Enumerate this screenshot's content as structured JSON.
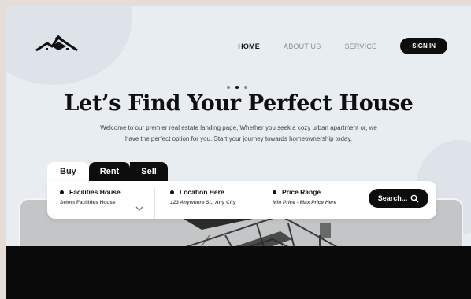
{
  "nav": {
    "home": "HOME",
    "about": "ABOUT US",
    "service": "SERVICE",
    "signin": "SIGN IN"
  },
  "hero": {
    "title": "Let’s Find Your Perfect House",
    "subtitle_line1": "Welcome to our premier real estate landing page, Whether you seek a cozy urban apartment or, we",
    "subtitle_line2": "have the perfect option for you. Start your journey towards homeownership today."
  },
  "tabs": [
    "Buy",
    "Rent",
    "Sell"
  ],
  "search": {
    "facilities": {
      "title": "Facilities House",
      "value": "Select Facilities House"
    },
    "location": {
      "title": "Location Here",
      "value": "123 Anywhere St., Any City"
    },
    "price": {
      "title": "Price Range",
      "value": "Min Price - Max Price Here"
    },
    "button": "Search..."
  },
  "colors": {
    "accent": "#0d0d0d",
    "background": "#e8edf1"
  },
  "icons": {
    "logo": "house-roof-logo",
    "search": "search-icon",
    "chevron": "chevron-down-icon"
  }
}
